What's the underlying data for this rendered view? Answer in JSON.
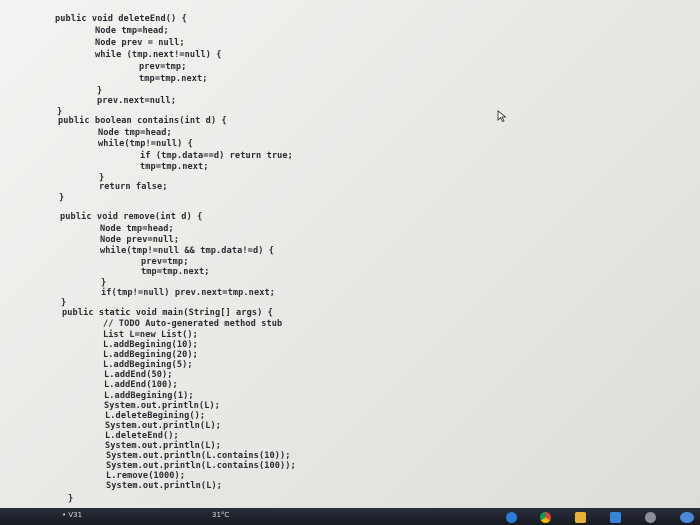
{
  "code": {
    "lines": [
      "public void deleteEnd() {",
      "Node tmp=head;",
      "Node prev = null;",
      "while (tmp.next!=null) {",
      "prev=tmp;",
      "tmp=tmp.next;",
      "}",
      "prev.next=null;",
      "}",
      "public boolean contains(int d) {",
      "Node tmp=head;",
      "while(tmp!=null) {",
      "if (tmp.data==d) return true;",
      "tmp=tmp.next;",
      "}",
      "return false;",
      "}",
      "public void remove(int d) {",
      "Node tmp=head;",
      "Node prev=null;",
      "while(tmp!=null && tmp.data!=d) {",
      "prev=tmp;",
      "tmp=tmp.next;",
      "}",
      "if(tmp!=null) prev.next=tmp.next;",
      "}",
      "public static void main(String[] args) {",
      "// TODO Auto-generated method stub",
      "List L=new List();",
      "L.addBegining(10);",
      "L.addBegining(20);",
      "L.addBegining(5);",
      "L.addEnd(50);",
      "L.addEnd(100);",
      "L.addBegining(1);",
      "System.out.println(L);",
      "L.deleteBegining();",
      "System.out.println(L);",
      "L.deleteEnd();",
      "System.out.println(L);",
      "System.out.println(L.contains(10));",
      "System.out.println(L.contains(100));",
      "L.remove(1000);",
      "System.out.println(L);",
      "}"
    ]
  },
  "taskbar": {
    "left_label": "• V31",
    "temp_label": "31°C"
  },
  "icons": {
    "cursor": "mouse-pointer-icon",
    "tray": [
      "edge-icon",
      "chrome-icon",
      "folder-icon",
      "store-icon",
      "settings-icon"
    ]
  }
}
